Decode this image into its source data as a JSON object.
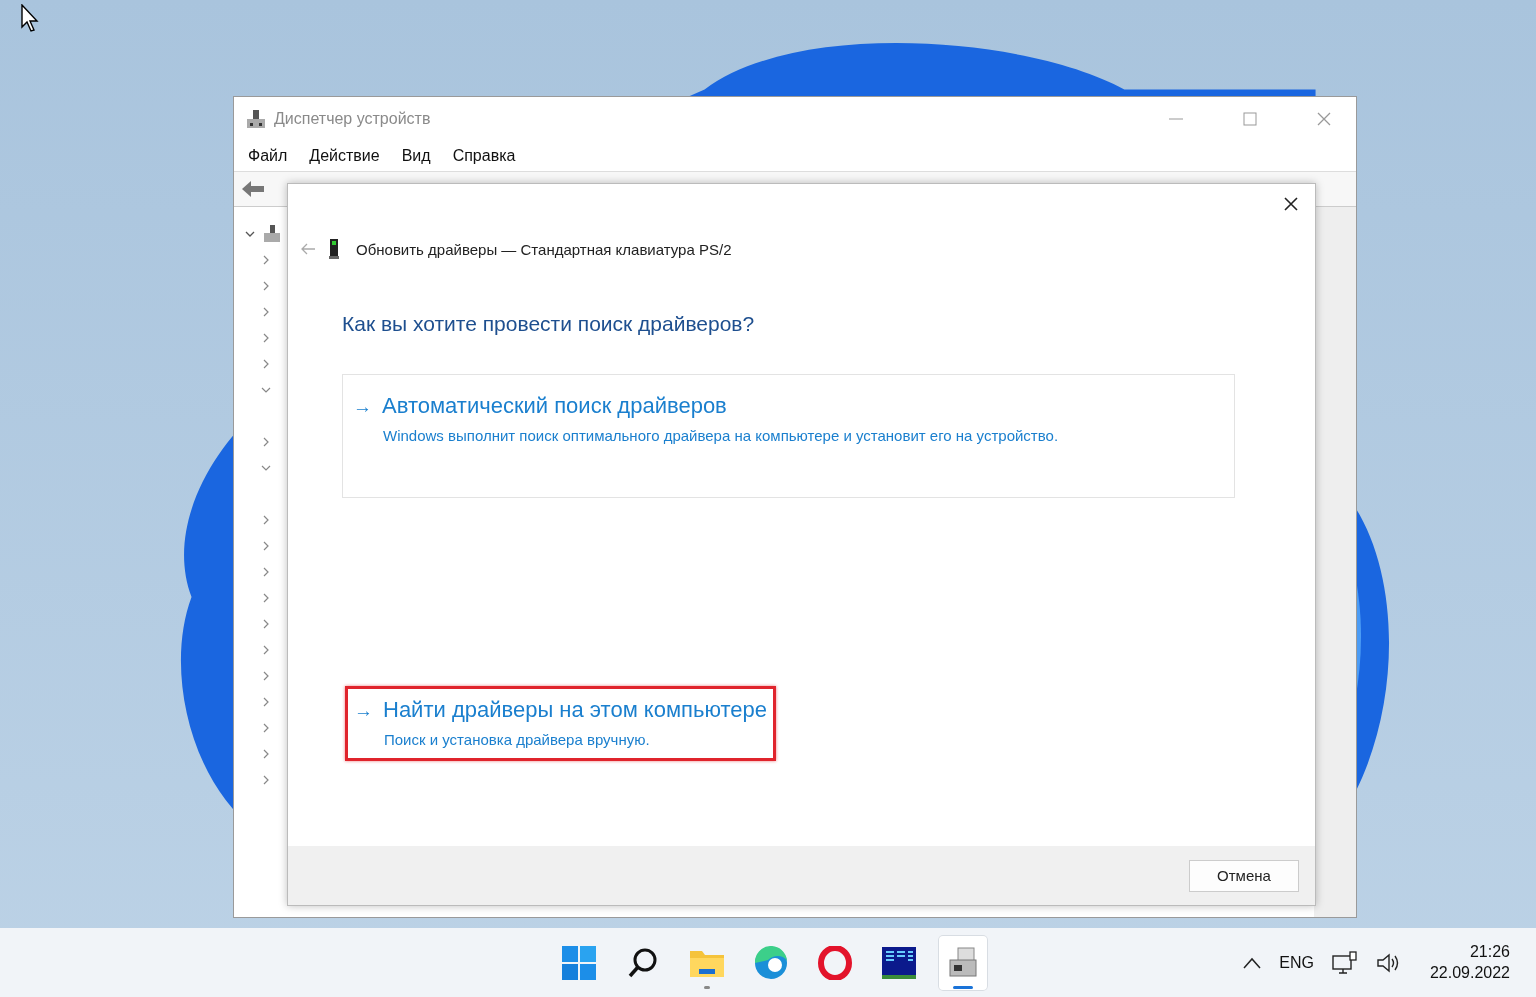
{
  "window": {
    "title": "Диспетчер устройств"
  },
  "menu": [
    "Файл",
    "Действие",
    "Вид",
    "Справка"
  ],
  "tree": {
    "expanded": true,
    "children": [
      {
        "expanded": false
      },
      {
        "expanded": false
      },
      {
        "expanded": false
      },
      {
        "expanded": false
      },
      {
        "expanded": false
      },
      {
        "expanded": true
      },
      {
        "expanded": false
      },
      {
        "expanded": true
      },
      {
        "expanded": false
      },
      {
        "expanded": false
      },
      {
        "expanded": false
      },
      {
        "expanded": false
      },
      {
        "expanded": false
      },
      {
        "expanded": false
      },
      {
        "expanded": false
      },
      {
        "expanded": false
      },
      {
        "expanded": false
      },
      {
        "expanded": false
      },
      {
        "expanded": false
      }
    ]
  },
  "dialog": {
    "title": "Обновить драйверы — Стандартная клавиатура PS/2",
    "question": "Как вы хотите провести поиск драйверов?",
    "options": [
      {
        "arrow": "→",
        "title": "Автоматический поиск драйверов",
        "description": "Windows выполнит поиск оптимального драйвера на компьютере и установит его на устройство.",
        "highlighted": false,
        "boxed": true
      },
      {
        "arrow": "→",
        "title": "Найти драйверы на этом компьютере",
        "description": "Поиск и установка драйвера вручную.",
        "highlighted": true,
        "boxed": false
      }
    ],
    "cancel": "Отмена"
  },
  "taskbar": {
    "apps": [
      {
        "kind": "start",
        "running": false,
        "selected": false
      },
      {
        "kind": "search",
        "running": false,
        "selected": false
      },
      {
        "kind": "folder",
        "running": true,
        "selected": false
      },
      {
        "kind": "edge",
        "running": false,
        "selected": false
      },
      {
        "kind": "opera",
        "running": false,
        "selected": false
      },
      {
        "kind": "monitor",
        "running": false,
        "selected": false
      },
      {
        "kind": "devmgr",
        "running": true,
        "selected": true
      }
    ],
    "language": "ENG",
    "time": "21:26",
    "date": "22.09.2022"
  }
}
